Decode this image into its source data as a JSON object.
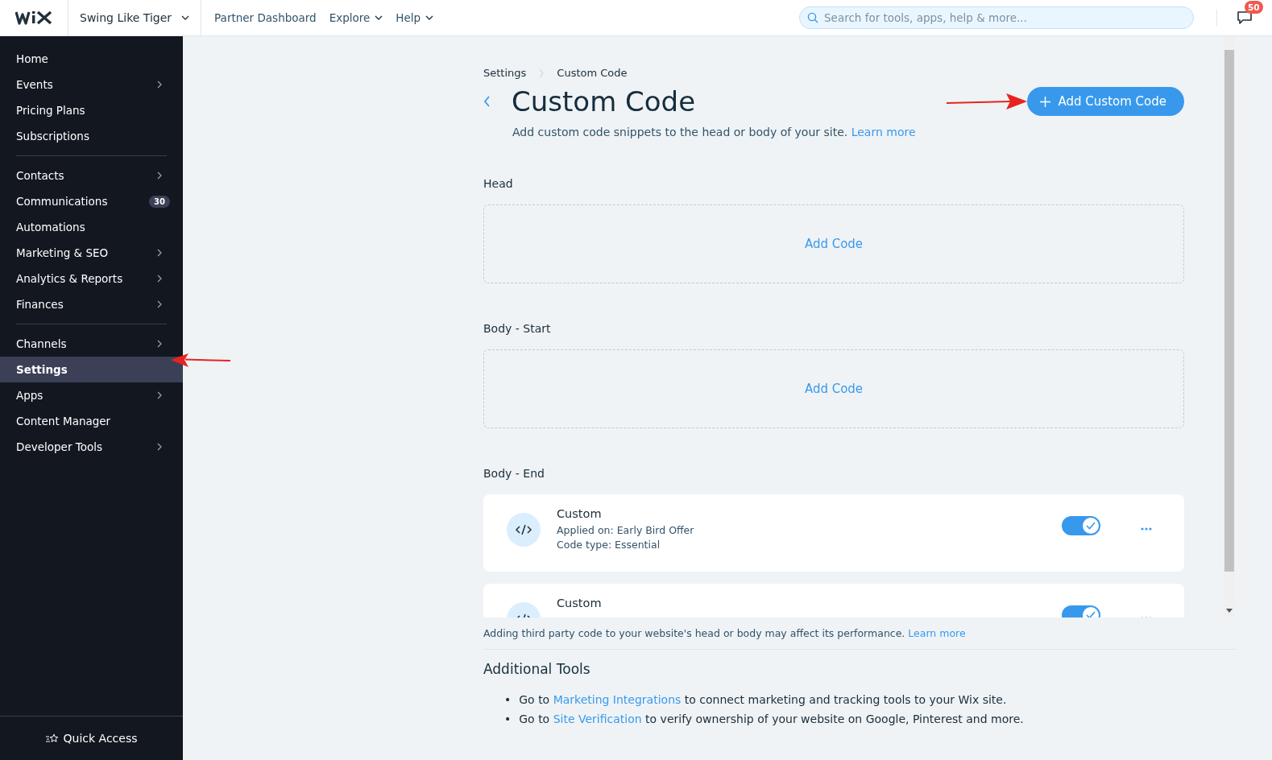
{
  "topbar": {
    "site_name": "Swing Like Tiger",
    "nav": [
      {
        "label": "Partner Dashboard",
        "dropdown": false
      },
      {
        "label": "Explore",
        "dropdown": true
      },
      {
        "label": "Help",
        "dropdown": true
      }
    ],
    "search": {
      "placeholder": "Search for tools, apps, help & more..."
    },
    "notifications": {
      "count": "50"
    }
  },
  "sidebar": {
    "groups": [
      [
        {
          "label": "Home",
          "selected": false,
          "submenu": false
        },
        {
          "label": "Events",
          "selected": false,
          "submenu": true
        },
        {
          "label": "Pricing Plans",
          "selected": false,
          "submenu": false
        },
        {
          "label": "Subscriptions",
          "selected": false,
          "submenu": false
        }
      ],
      [
        {
          "label": "Contacts",
          "selected": false,
          "submenu": true
        },
        {
          "label": "Communications",
          "selected": false,
          "submenu": false,
          "badge": "30"
        },
        {
          "label": "Automations",
          "selected": false,
          "submenu": false
        },
        {
          "label": "Marketing & SEO",
          "selected": false,
          "submenu": true
        },
        {
          "label": "Analytics & Reports",
          "selected": false,
          "submenu": true
        },
        {
          "label": "Finances",
          "selected": false,
          "submenu": true
        }
      ],
      [
        {
          "label": "Channels",
          "selected": false,
          "submenu": true
        },
        {
          "label": "Settings",
          "selected": true,
          "submenu": false
        },
        {
          "label": "Apps",
          "selected": false,
          "submenu": true
        },
        {
          "label": "Content Manager",
          "selected": false,
          "submenu": false
        },
        {
          "label": "Developer Tools",
          "selected": false,
          "submenu": true
        }
      ]
    ],
    "quick_access": "Quick Access"
  },
  "breadcrumbs": [
    "Settings",
    "Custom Code"
  ],
  "page": {
    "title": "Custom Code",
    "subtitle": "Add custom code snippets to the head or body of your site.",
    "subtitle_link": "Learn more",
    "primary_button": "Add Custom Code"
  },
  "sections": [
    {
      "title": "Head",
      "empty_action": "Add Code"
    },
    {
      "title": "Body - Start",
      "empty_action": "Add Code"
    },
    {
      "title": "Body - End",
      "snippets": [
        {
          "name": "Custom",
          "details": [
            "Applied on: Early Bird Offer",
            "Code type: Essential"
          ],
          "enabled": true
        },
        {
          "name": "Custom",
          "enabled": true
        }
      ]
    }
  ],
  "footer_note": {
    "text": "Adding third party code to your website's head or body may affect its performance.",
    "link": "Learn more"
  },
  "additional_tools": {
    "title": "Additional Tools",
    "items": [
      {
        "marker": "•",
        "prefix": "Go to",
        "link": "Marketing Integrations",
        "suffix": "to connect marketing and tracking tools to your Wix site."
      },
      {
        "marker": "•",
        "prefix": "Go to",
        "link": "Site Verification",
        "suffix": "to verify ownership of your website on Google, Pinterest and more."
      }
    ]
  },
  "annotations": [
    {
      "kind": "arrow"
    },
    {
      "kind": "arrow"
    }
  ]
}
